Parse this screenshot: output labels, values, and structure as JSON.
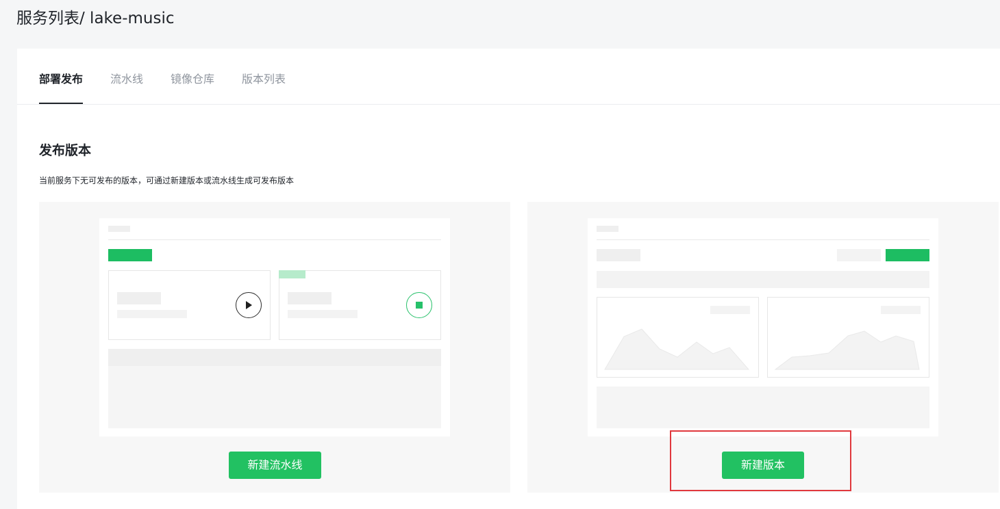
{
  "page": {
    "title": "服务列表/ lake-music"
  },
  "tabs": [
    {
      "label": "部署发布",
      "active": true
    },
    {
      "label": "流水线",
      "active": false
    },
    {
      "label": "镜像仓库",
      "active": false
    },
    {
      "label": "版本列表",
      "active": false
    }
  ],
  "section": {
    "title": "发布版本",
    "description": "当前服务下无可发布的版本，可通过新建版本或流水线生成可发布版本"
  },
  "cards": {
    "pipeline": {
      "button_label": "新建流水线",
      "icons": [
        "play-icon",
        "stop-icon"
      ]
    },
    "version": {
      "button_label": "新建版本",
      "highlighted": true
    }
  },
  "colors": {
    "accent": "#22c162",
    "highlight": "#e0383d",
    "text": "#1f2329",
    "muted": "#8f959e"
  }
}
